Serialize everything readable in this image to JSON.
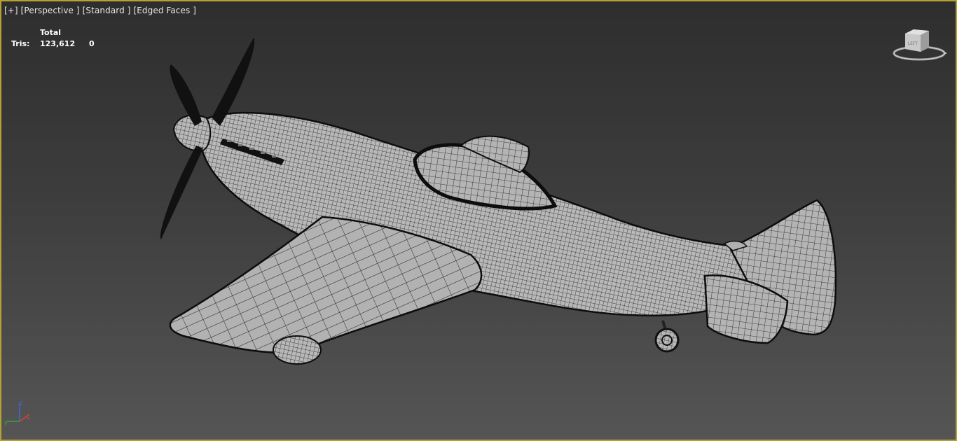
{
  "viewport": {
    "labels": {
      "plus": "[+]",
      "view": "[Perspective ]",
      "shading": "[Standard ]",
      "edges": "[Edged Faces ]"
    },
    "stats": {
      "header": "Total",
      "tris_label": "Tris:",
      "tris_total": "123,612",
      "tris_selected": "0"
    },
    "viewcube_face": "LEFT",
    "colors": {
      "border": "#b8a22f",
      "background_top": "#2e2e2e",
      "background_bottom": "#555555",
      "mesh_fill": "#b4b4b4",
      "wire": "#111111"
    },
    "icons": [
      "viewcube-icon",
      "axis-tripod-icon"
    ]
  }
}
